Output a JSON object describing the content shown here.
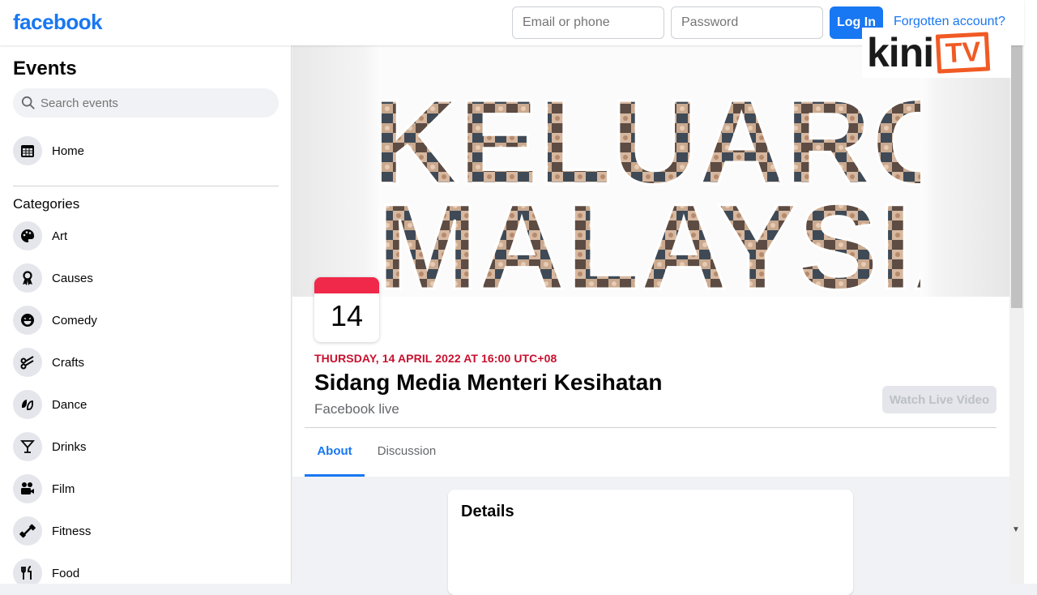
{
  "topbar": {
    "logo": "facebook",
    "email_placeholder": "Email or phone",
    "password_placeholder": "Password",
    "login_label": "Log In",
    "forgot_label": "Forgotten account?"
  },
  "watermark": {
    "brand": "kini",
    "tv": "TV"
  },
  "sidebar": {
    "title": "Events",
    "search_placeholder": "Search events",
    "home_label": "Home",
    "categories_title": "Categories",
    "categories": [
      "Art",
      "Causes",
      "Comedy",
      "Crafts",
      "Dance",
      "Drinks",
      "Film",
      "Fitness",
      "Food"
    ]
  },
  "event": {
    "cover_text_line1": "KELUARG",
    "cover_text_line2": "MALAYSIA",
    "day": "14",
    "when": "THURSDAY, 14 APRIL 2022 AT 16:00 UTC+08",
    "title": "Sidang Media Menteri Kesihatan",
    "subtitle": "Facebook live",
    "watch_label": "Watch Live Video"
  },
  "tabs": {
    "about": "About",
    "discussion": "Discussion"
  },
  "details": {
    "title": "Details"
  },
  "colors": {
    "brand": "#1877f2",
    "date_accent": "#f02849",
    "when_text": "#c8102e",
    "kini_orange": "#f15a24"
  }
}
